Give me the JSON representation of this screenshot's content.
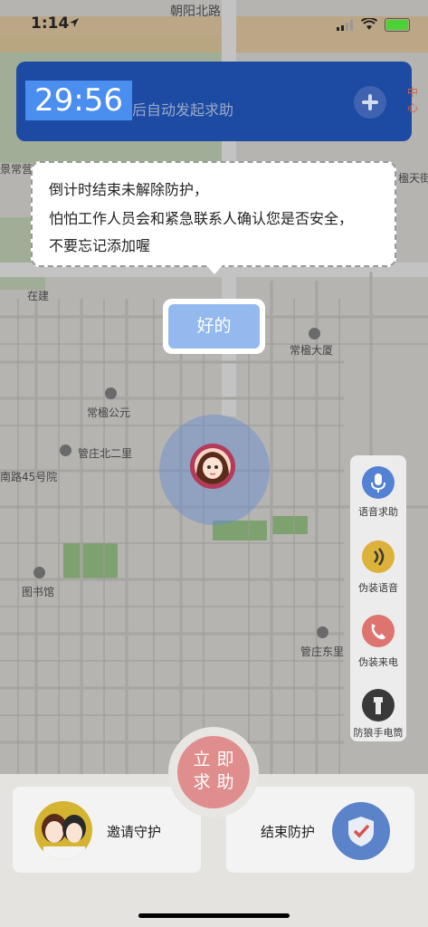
{
  "status_bar": {
    "time": "1:14",
    "road_name": "朝阳北路"
  },
  "banner": {
    "countdown": "29:56",
    "message": "后自动发起求助",
    "partial_label": "中心",
    "add_icon": "plus-icon"
  },
  "tooltip": {
    "lines": [
      "倒计时结束未解除防护，",
      "怕怕工作人员会和紧急联系人确认您是否安全，",
      "不要忘记添加喔"
    ],
    "confirm_label": "好的"
  },
  "map_labels": {
    "building": "常楹大厦",
    "park": "常楹公元",
    "area": "管庄北二里",
    "road": "南路45号院",
    "library": "图书馆",
    "east": "管庄东里",
    "construction": "在建",
    "left_edge": "景常营",
    "right_edge": "楹天街"
  },
  "tools": [
    {
      "label": "语音求助",
      "icon": "microphone-icon",
      "color": "#4e7fd6"
    },
    {
      "label": "伪装语音",
      "icon": "sound-wave-icon",
      "color": "#e0b234"
    },
    {
      "label": "伪装来电",
      "icon": "phone-icon",
      "color": "#e0716c"
    },
    {
      "label": "防狼手电筒",
      "icon": "flashlight-icon",
      "color": "#333333"
    }
  ],
  "sos": {
    "line1": "立即",
    "line2": "求助"
  },
  "bottom": {
    "invite_label": "邀请守护",
    "end_label": "结束防护"
  }
}
